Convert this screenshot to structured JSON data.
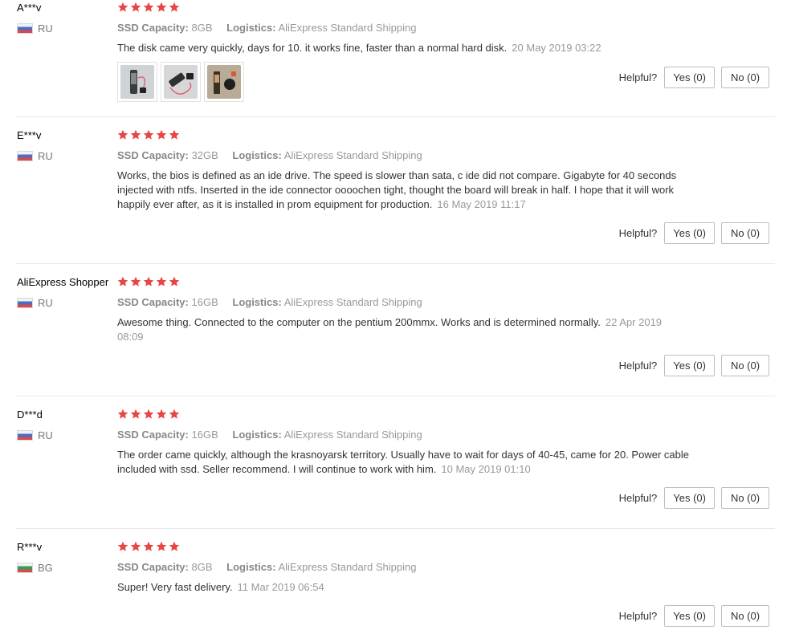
{
  "colors": {
    "star": "#e84545",
    "divider": "#e8e8e8",
    "muted": "#999999"
  },
  "labels": {
    "ssd": "SSD Capacity:",
    "logistics": "Logistics:",
    "helpful": "Helpful?"
  },
  "reviews": [
    {
      "user": "A***v",
      "country": "RU",
      "rating": 5,
      "ssd": "8GB",
      "logistics": "AliExpress Standard Shipping",
      "text": "The disk came very quickly, days for 10. it works fine, faster than a normal hard disk.",
      "date": "20 May 2019 03:22",
      "yes": "Yes (0)",
      "no": "No (0)"
    },
    {
      "user": "E***v",
      "country": "RU",
      "rating": 5,
      "ssd": "32GB",
      "logistics": "AliExpress Standard Shipping",
      "text": "Works, the bios is defined as an ide drive. The speed is slower than sata, c ide did not compare. Gigabyte for 40 seconds injected with ntfs. Inserted in the ide connector oooochen tight, thought the board will break in half. I hope that it will work happily ever after, as it is installed in prom equipment for production.",
      "date": "16 May 2019 11:17",
      "yes": "Yes (0)",
      "no": "No (0)"
    },
    {
      "user": "AliExpress Shopper",
      "country": "RU",
      "rating": 5,
      "ssd": "16GB",
      "logistics": "AliExpress Standard Shipping",
      "text": "Awesome thing. Connected to the computer on the pentium 200mmx. Works and is determined normally.",
      "date": "22 Apr 2019 08:09",
      "yes": "Yes (0)",
      "no": "No (0)"
    },
    {
      "user": "D***d",
      "country": "RU",
      "rating": 5,
      "ssd": "16GB",
      "logistics": "AliExpress Standard Shipping",
      "text": "The order came quickly, although the krasnoyarsk territory. Usually have to wait for days of 40-45, came for 20. Power cable included with ssd. Seller recommend. I will continue to work with him.",
      "date": "10 May 2019 01:10",
      "yes": "Yes (0)",
      "no": "No (0)"
    },
    {
      "user": "R***v",
      "country": "BG",
      "rating": 5,
      "ssd": "8GB",
      "logistics": "AliExpress Standard Shipping",
      "text": "Super! Very fast delivery.",
      "date": "11 Mar 2019 06:54",
      "yes": "Yes (0)",
      "no": "No (0)"
    }
  ]
}
